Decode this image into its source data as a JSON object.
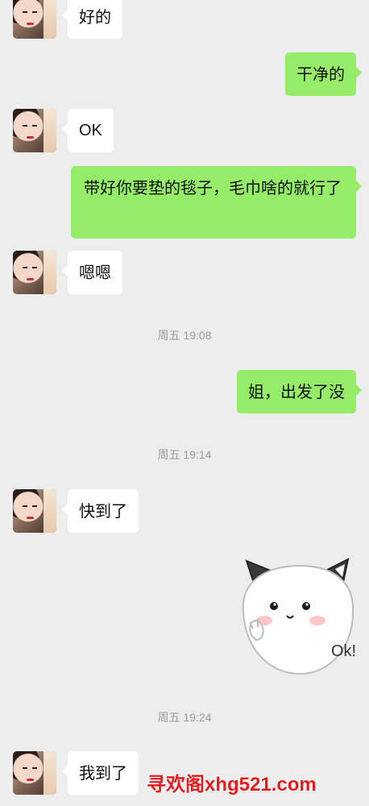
{
  "messages": [
    {
      "text": "好的"
    },
    {
      "text": "干净的"
    },
    {
      "text": "OK"
    },
    {
      "text": "带好你要垫的毯子，毛巾啥的就行了"
    },
    {
      "text": "嗯嗯"
    },
    {
      "text": "姐，出发了没"
    },
    {
      "text": "快到了"
    },
    {
      "text": "我到了"
    }
  ],
  "timestamps": [
    "周五 19:08",
    "周五 19:14",
    "周五 19:24"
  ],
  "sticker": {
    "label": "Ok!",
    "icon": "cat-ok-sticker-icon"
  },
  "watermark": {
    "text": "寻欢阁xhg521.com"
  },
  "colors": {
    "out_bubble": "#95ec69",
    "in_bubble": "#ffffff",
    "background": "#ededed",
    "watermark": "#e8191d"
  }
}
